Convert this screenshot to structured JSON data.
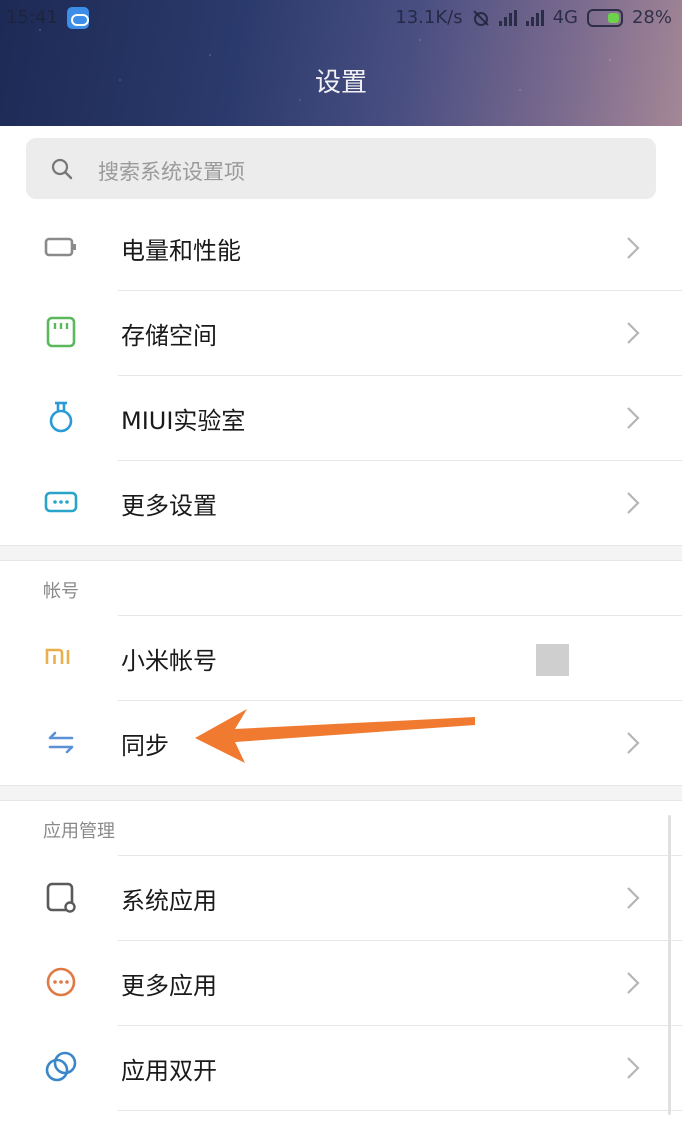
{
  "status_bar": {
    "time": "15:41",
    "net_speed": "13.1K/s",
    "network": "4G",
    "battery": "28%"
  },
  "header": {
    "title": "设置"
  },
  "search": {
    "placeholder": "搜索系统设置项"
  },
  "group1": [
    {
      "label": "电量和性能",
      "icon": "battery-icon",
      "color": "#8a8a8a"
    },
    {
      "label": "存储空间",
      "icon": "storage-icon",
      "color": "#5cb85c"
    },
    {
      "label": "MIUI实验室",
      "icon": "flask-icon",
      "color": "#2a9bd6"
    },
    {
      "label": "更多设置",
      "icon": "more-settings-icon",
      "color": "#2aa4c9"
    }
  ],
  "account_section": {
    "title": "帐号",
    "items": [
      {
        "label": "小米帐号",
        "icon": "mi-logo-icon",
        "color": "#e8b04a"
      },
      {
        "label": "同步",
        "icon": "sync-icon",
        "color": "#5b8fd6"
      }
    ]
  },
  "apps_section": {
    "title": "应用管理",
    "items": [
      {
        "label": "系统应用",
        "icon": "system-apps-icon",
        "color": "#5a5a5a"
      },
      {
        "label": "更多应用",
        "icon": "more-apps-icon",
        "color": "#e07a45"
      },
      {
        "label": "应用双开",
        "icon": "dual-apps-icon",
        "color": "#3b86c9"
      }
    ]
  },
  "annotation": {
    "arrow_color": "#f07a30"
  }
}
